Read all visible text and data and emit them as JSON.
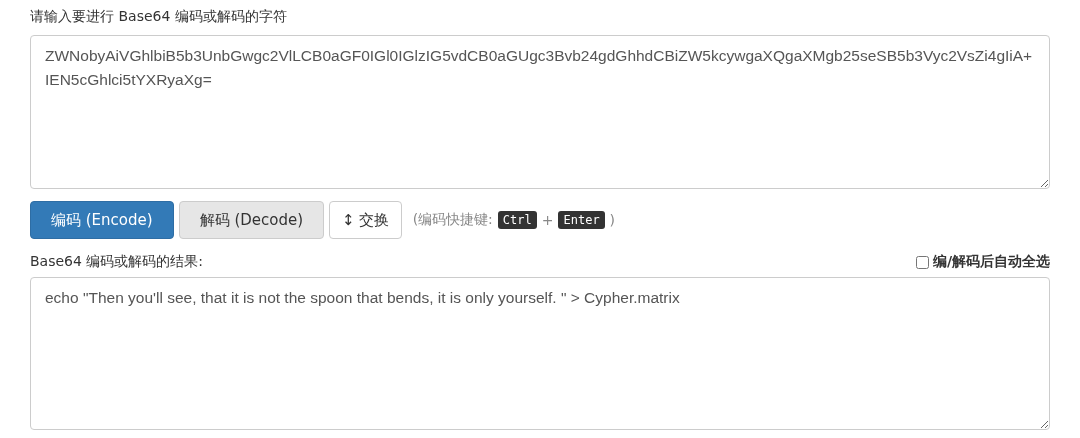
{
  "input_label": "请输入要进行 Base64 编码或解码的字符",
  "input_value": "ZWNobyAiVGhlbiB5b3UnbGwgc2VlLCB0aGF0IGl0IGlzIG5vdCB0aGUgc3Bvb24gdGhhdCBiZW5kcywgaXQgaXMgb25seSB5b3Vyc2VsZi4gIiA+IEN5cGhlci5tYXRyaXg=",
  "buttons": [
    {
      "kind": "primary",
      "label": "编码 (Encode)"
    },
    {
      "kind": "default",
      "label": "解码 (Decode)"
    },
    {
      "kind": "swap",
      "icon": "↕",
      "label": "交换"
    }
  ],
  "shortcut": {
    "open": "(编码快捷键:",
    "keys": [
      "Ctrl",
      "Enter"
    ],
    "plus": "+",
    "close": ")"
  },
  "output_label": "Base64 编码或解码的结果:",
  "auto_select": {
    "label": "编/解码后自动全选",
    "checked": false
  },
  "output_value": "echo \"Then you'll see, that it is not the spoon that bends, it is only yourself. \" > Cypher.matrix"
}
